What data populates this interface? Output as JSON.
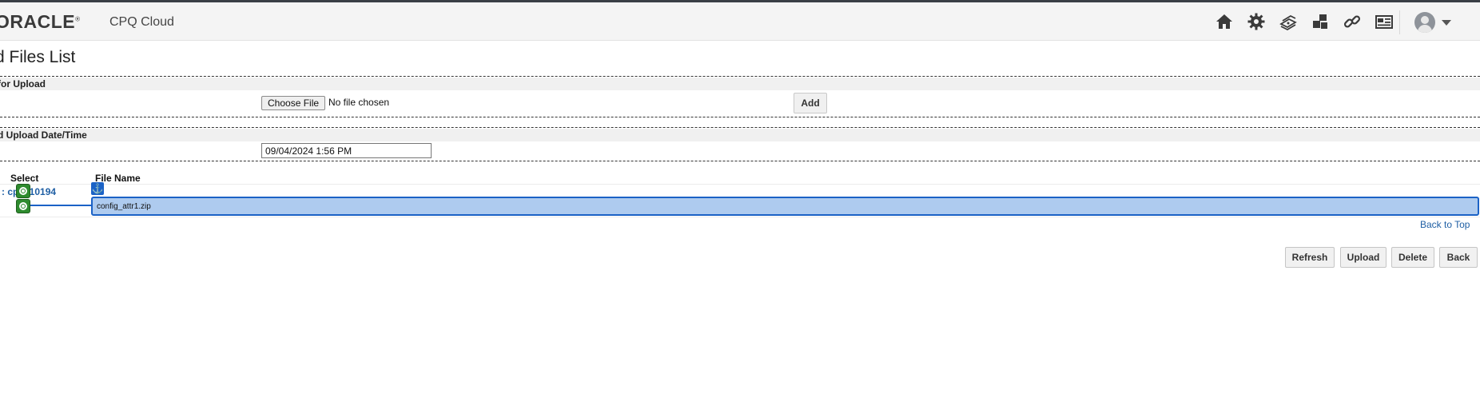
{
  "header": {
    "logo": "ORACLE",
    "logo_mark": "®",
    "product": "CPQ Cloud",
    "icons": [
      "home-icon",
      "gear-icon",
      "stacked-money-icon",
      "blocks-icon",
      "link-icon",
      "id-card-icon"
    ],
    "user_menu_icon": "user-avatar-icon"
  },
  "page": {
    "title": "d Files List"
  },
  "upload_section": {
    "label": " for Upload",
    "choose_file_label": "Choose File",
    "no_file_text": "No file chosen",
    "add_label": "Add"
  },
  "date_section": {
    "label": "d Upload Date/Time",
    "value": "09/04/2024 1:56 PM"
  },
  "table": {
    "columns": [
      "Select",
      "File Name"
    ],
    "group_label": ": cp__10194",
    "rows": [
      {
        "file_name": "config_attr1.zip",
        "selected": true
      }
    ]
  },
  "links": {
    "back_to_top": "Back to Top"
  },
  "actions": [
    "Refresh",
    "Upload",
    "Delete",
    "Back"
  ],
  "colors": {
    "accent_blue": "#1b62c6",
    "selected_row": "#aecbef",
    "select_marker": "#2e8b2e",
    "link": "#1f5fa4"
  }
}
